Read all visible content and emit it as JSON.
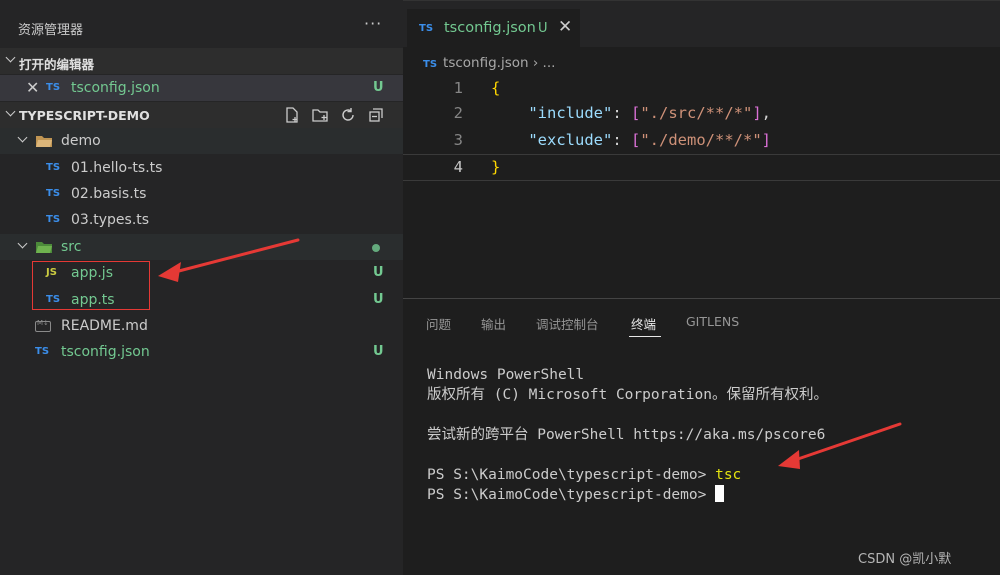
{
  "explorer": {
    "title": "资源管理器",
    "more": "···",
    "open_editors": {
      "header": "打开的编辑器",
      "items": [
        {
          "icon": "TS",
          "label": "tsconfig.json",
          "status": "U"
        }
      ]
    },
    "project": {
      "header": "TYPESCRIPT-DEMO",
      "folders": [
        {
          "label": "demo",
          "files": [
            {
              "icon": "TS",
              "label": "01.hello-ts.ts"
            },
            {
              "icon": "TS",
              "label": "02.basis.ts"
            },
            {
              "icon": "TS",
              "label": "03.types.ts"
            }
          ]
        },
        {
          "label": "src",
          "files": [
            {
              "icon": "JS",
              "label": "app.js",
              "status": "U"
            },
            {
              "icon": "TS",
              "label": "app.ts",
              "status": "U"
            }
          ]
        }
      ],
      "root_files": [
        {
          "icon": "markdown-icon",
          "label": "README.md"
        },
        {
          "icon": "TS",
          "label": "tsconfig.json",
          "status": "U"
        }
      ]
    }
  },
  "editor": {
    "tab": {
      "icon": "TS",
      "title": "tsconfig.json",
      "status": "U"
    },
    "breadcrumb": {
      "file": "tsconfig.json",
      "rest": "› ..."
    },
    "lines": [
      {
        "num": "1",
        "text": "{"
      },
      {
        "num": "2",
        "key": "\"include\"",
        "value": "\"./src/**/*\""
      },
      {
        "num": "3",
        "key": "\"exclude\"",
        "value": "\"./demo/**/*\""
      },
      {
        "num": "4",
        "text": "}"
      }
    ]
  },
  "panel": {
    "tabs": [
      "问题",
      "输出",
      "调试控制台",
      "终端",
      "GITLENS"
    ],
    "active_tab": "终端",
    "terminal": {
      "line1": "Windows PowerShell",
      "line2": "版权所有 (C) Microsoft Corporation。保留所有权利。",
      "line3": "尝试新的跨平台 PowerShell https://aka.ms/pscore6",
      "prompt1": "PS S:\\KaimoCode\\typescript-demo> ",
      "command": "tsc",
      "prompt2": "PS S:\\KaimoCode\\typescript-demo> "
    }
  },
  "watermark": "CSDN @凯小默",
  "colors": {
    "git_untracked": "#73c991",
    "ts_icon": "#3b8eea",
    "js_icon": "#cbcb41",
    "annotation": "#e53935"
  }
}
